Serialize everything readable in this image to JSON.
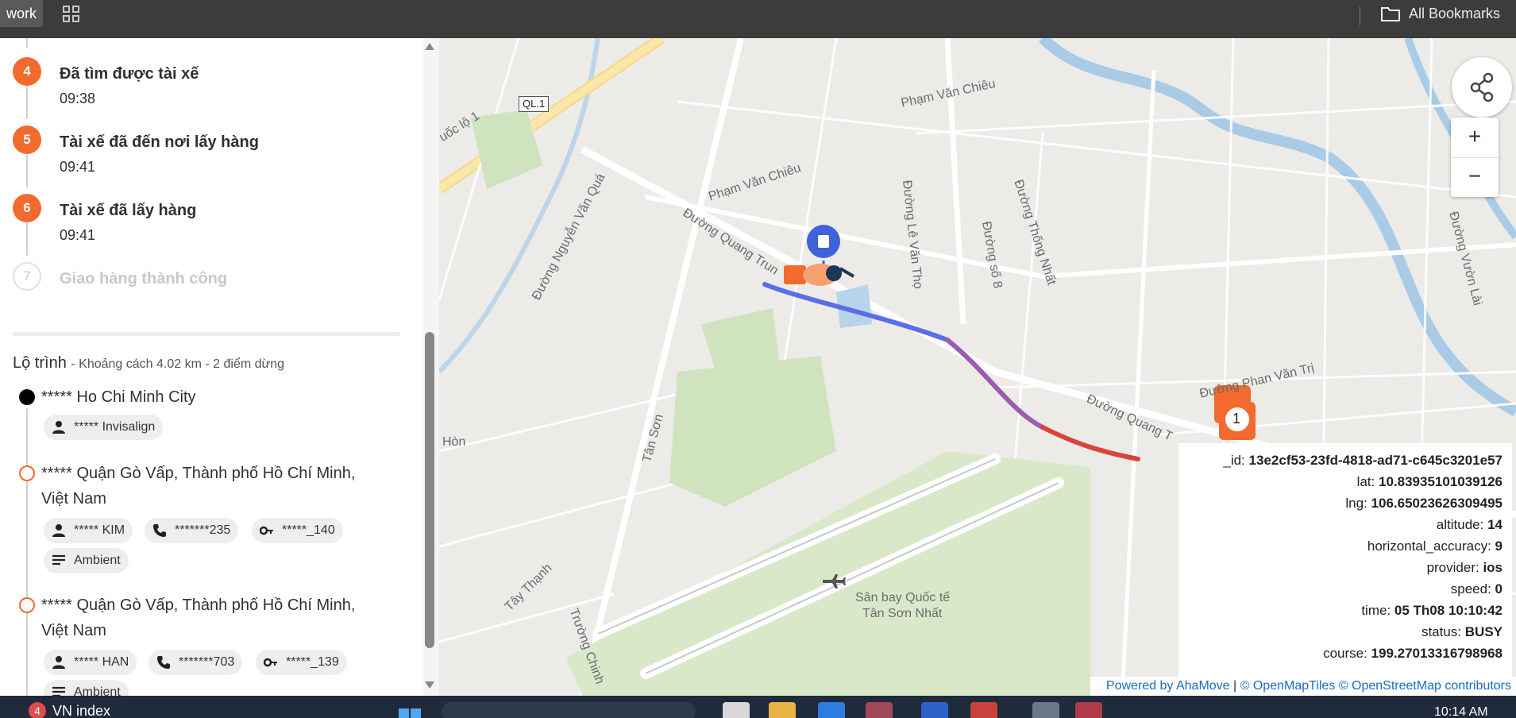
{
  "bookmarks_bar": {
    "profile_label": "work",
    "apps_icon": "apps-grid-icon",
    "all_bookmarks_label": "All Bookmarks"
  },
  "steps": [
    {
      "number": "4",
      "title": "Đã tìm được tài xế",
      "time": "09:38",
      "status": "done"
    },
    {
      "number": "5",
      "title": "Tài xế đã đến nơi lấy hàng",
      "time": "09:41",
      "status": "done"
    },
    {
      "number": "6",
      "title": "Tài xế đã lấy hàng",
      "time": "09:41",
      "status": "done"
    },
    {
      "number": "7",
      "title": "Giao hàng thành công",
      "time": "",
      "status": "pending"
    }
  ],
  "route": {
    "title": "Lộ trình",
    "summary": "- Khoảng cách 4.02 km - 2 điểm dừng",
    "stops": [
      {
        "address": "***** Ho Chi Minh City",
        "chips": [
          {
            "icon": "person-icon",
            "text": "***** Invisalign"
          }
        ]
      },
      {
        "address_line1": "***** Quận Gò Vấp, Thành phố Hồ Chí Minh,",
        "address_line2": "Việt Nam",
        "chips": [
          {
            "icon": "person-icon",
            "text": "***** KIM"
          },
          {
            "icon": "phone-icon",
            "text": "*******235"
          },
          {
            "icon": "key-icon",
            "text": "*****_140"
          },
          {
            "icon": "notes-icon",
            "text": "Ambient"
          }
        ]
      },
      {
        "address_line1": "***** Quận Gò Vấp, Thành phố Hồ Chí Minh,",
        "address_line2": "Việt Nam",
        "chips": [
          {
            "icon": "person-icon",
            "text": "***** HAN"
          },
          {
            "icon": "phone-icon",
            "text": "*******703"
          },
          {
            "icon": "key-icon",
            "text": "*****_139"
          },
          {
            "icon": "notes-icon",
            "text": "Ambient"
          }
        ]
      }
    ]
  },
  "map": {
    "labels": {
      "ql1": "QL.1",
      "quoc_lo_1": "uốc lộ 1",
      "pham_van_chieu_1": "Phạm Văn Chiêu",
      "pham_van_chieu_2": "Phạm Văn Chiêu",
      "nguyen_van_qua": "Đường Nguyễn Văn Quá",
      "quang_trung": "Đường Quang Trun",
      "le_van_tho": "Đường Lê Văn Thọ",
      "so_8": "Đường số 8",
      "thong_nhat": "Đường Thống Nhất",
      "vuon_lai": "Đường Vườn Lài",
      "tan_son": "Tân Sơn",
      "hon": "Hòn",
      "tay_thanh": "Tây Thạnh",
      "truong_chinh": "Trường Chinh",
      "airport_1": "Sân bay Quốc tế",
      "airport_2": "Tân Sơn Nhất",
      "quang_trung_2": "Đường Quang T",
      "pham_van_tri": "Đường Phan Văn Trị",
      "marker_1": "1"
    },
    "info": {
      "id_label": "_id:",
      "id_value": "13e2cf53-23fd-4818-ad71-c645c3201e57",
      "lat_label": "lat:",
      "lat_value": "10.83935101039126",
      "lng_label": "lng:",
      "lng_value": "106.65023626309495",
      "altitude_label": "altitude:",
      "altitude_value": "14",
      "hacc_label": "horizontal_accuracy:",
      "hacc_value": "9",
      "provider_label": "provider:",
      "provider_value": "ios",
      "speed_label": "speed:",
      "speed_value": "0",
      "time_label": "time:",
      "time_value": "05 Th08 10:10:42",
      "status_label": "status:",
      "status_value": "BUSY",
      "course_label": "course:",
      "course_value": "199.27013316798968"
    },
    "zoom_in": "+",
    "zoom_out": "−",
    "attribution_powered": "Powered by AhaMove",
    "attribution_sep": " | ",
    "attribution_omt": "© OpenMapTiles",
    "attribution_osm": "© OpenStreetMap contributors"
  },
  "taskbar": {
    "badge_count": "4",
    "ticker_text": "VN index",
    "clock": "10:14 AM"
  },
  "colors": {
    "accent_orange": "#f26a2e",
    "route_blue": "#5b6ee8",
    "route_purple": "#9a5bb0",
    "route_red": "#d9443b"
  }
}
